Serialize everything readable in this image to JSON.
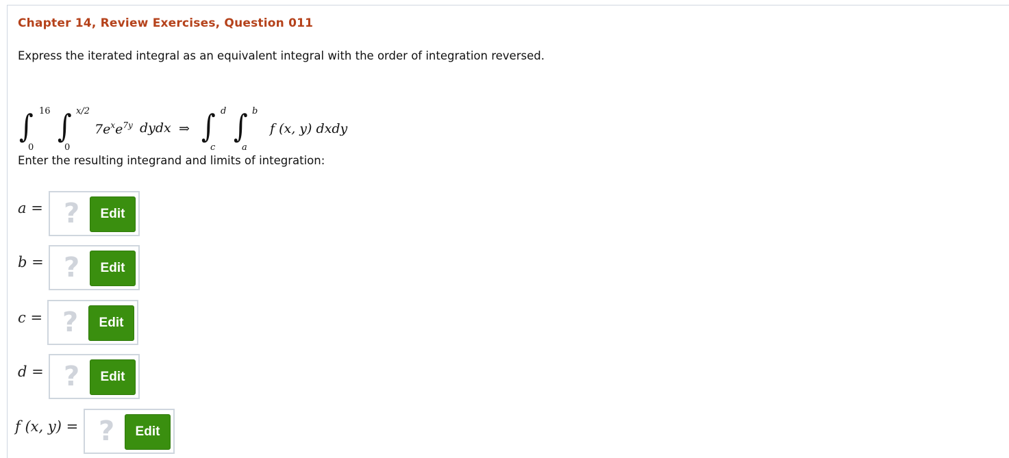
{
  "question": {
    "title": "Chapter 14, Review Exercises, Question 011",
    "prompt": "Express the iterated integral as an equivalent integral with the order of integration reversed.",
    "enter_text": "Enter the resulting integrand and limits of integration:"
  },
  "equation": {
    "outer_upper": "16",
    "outer_lower": "0",
    "inner_upper": "x/2",
    "inner_lower": "0",
    "integrand_coef": "7e",
    "integrand_exp1": "x",
    "integrand_base2": "e",
    "integrand_exp2": "7y",
    "differentials_left": "dydx",
    "arrow": "⇒",
    "r_outer_upper": "d",
    "r_outer_lower": "c",
    "r_inner_upper": "b",
    "r_inner_lower": "a",
    "r_integrand": "f (x, y) dxdy"
  },
  "answers": [
    {
      "label_var": "a",
      "label_suffix": " =",
      "placeholder": "?",
      "button": "Edit"
    },
    {
      "label_var": "b",
      "label_suffix": " =",
      "placeholder": "?",
      "button": "Edit"
    },
    {
      "label_var": "c",
      "label_suffix": " =",
      "placeholder": "?",
      "button": "Edit"
    },
    {
      "label_var": "d",
      "label_suffix": " =",
      "placeholder": "?",
      "button": "Edit"
    },
    {
      "label_var": "f (x, y)",
      "label_suffix": " =",
      "placeholder": "?",
      "button": "Edit"
    }
  ],
  "colors": {
    "title": "#b5421b",
    "edit_button": "#3a8f0f",
    "box_border": "#cfd6de",
    "placeholder": "#d0d4db"
  }
}
